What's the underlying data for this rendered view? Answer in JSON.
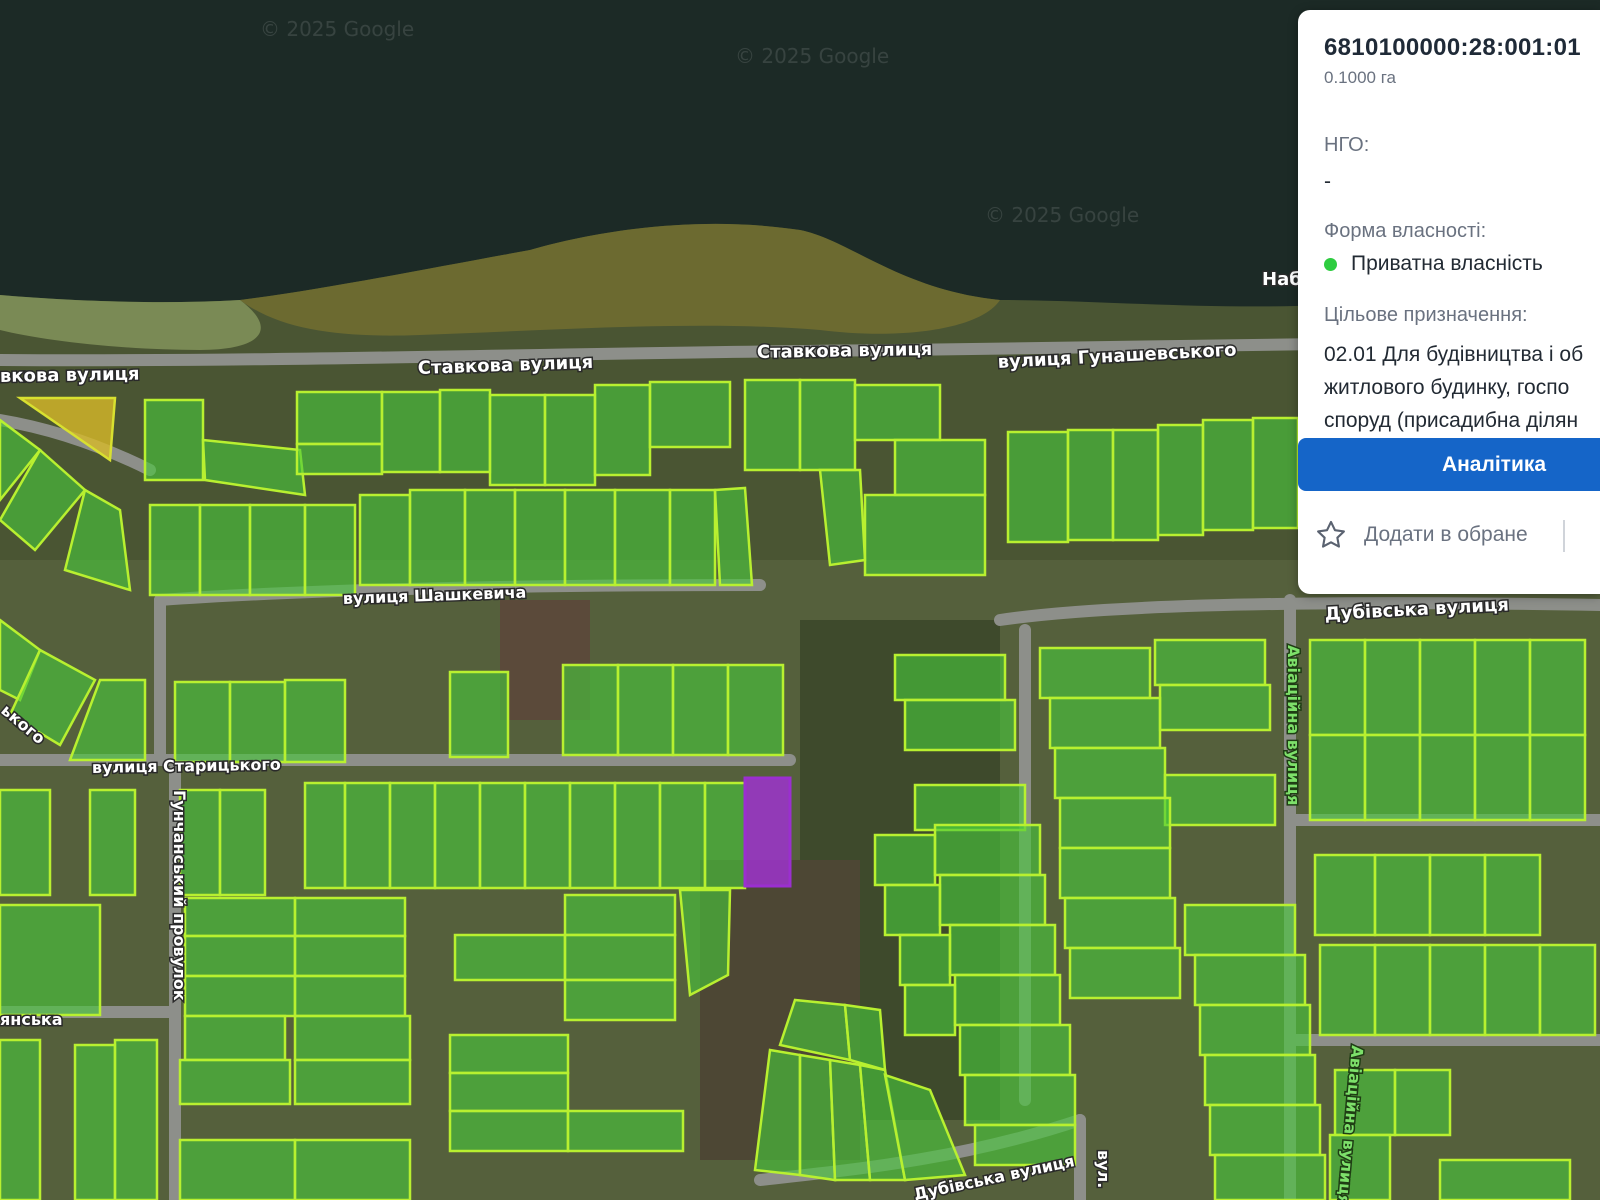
{
  "map": {
    "watermarks": [
      "© 2025 Google",
      "© 2025 Google",
      "© 2025 Google"
    ],
    "streets": {
      "stavkova_left": "вкова вулиця",
      "stavkova_1": "Ставкова вулиця",
      "stavkova_2": "Ставкова вулиця",
      "hunashevskoho": "вулиця Гунашевського",
      "shashkevycha": "вулиця Шашкевича",
      "dubivska_top": "Дубівська вулиця",
      "starytskoho": "вулиця Старицького",
      "hunchanskyi": "Гунчанський провулок",
      "aviatsiina_1": "Авіаційна вулиця",
      "aviatsiina_2": "Авіаційна вулиця",
      "dubivska_bottom": "Дубівська вулиця",
      "vul": "вул.",
      "nab": "Наб",
      "ovo": "ького",
      "yanska": "янська"
    },
    "colors": {
      "parcel_fill": "#48c83c",
      "parcel_stroke": "#b8f030",
      "selected_parcel": "#a032d2",
      "water": "#1c2a26"
    }
  },
  "panel": {
    "cadastral_number": "6810100000:28:001:01",
    "area": "0.1000 га",
    "ngo_label": "НГО:",
    "ngo_value": "-",
    "ownership_label": "Форма власності:",
    "ownership_value": "Приватна власність",
    "ownership_status_color": "#2ecc40",
    "purpose_label": "Цільове призначення:",
    "purpose_lines": [
      "02.01 Для будівництва і об",
      "житлового будинку, госпо",
      "споруд (присадибна ділян"
    ],
    "analytics_button": "Аналітика",
    "favorite_label": "Додати в обране",
    "favorite_icon": "star-outline-icon"
  }
}
